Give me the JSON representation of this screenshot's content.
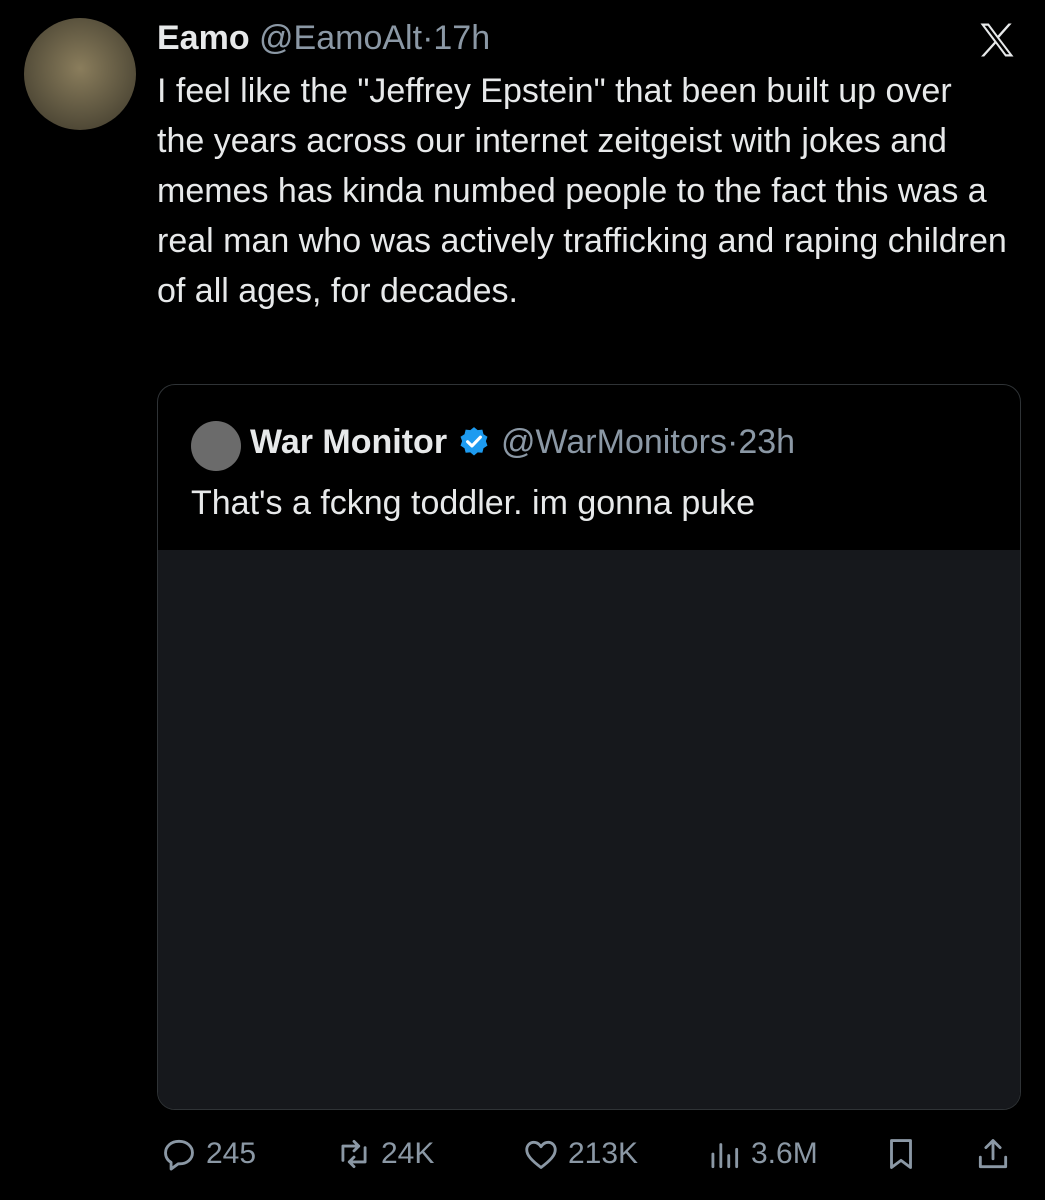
{
  "tweet": {
    "author_name": "Eamo",
    "author_handle": "@EamoAlt",
    "separator": "·",
    "time": "17h",
    "text": "I feel like the \"Jeffrey Epstein\" that been built up over the years across our internet zeitgeist with jokes and memes has kinda numbed people to the fact this was a real man who was actively trafficking and raping children of all ages, for decades."
  },
  "quoted": {
    "author_name": "War Monitor",
    "author_handle": "@WarMonitors",
    "separator": "·",
    "time": "23h",
    "text": "That's a fckng toddler. im gonna puke"
  },
  "actions": {
    "replies": "245",
    "reposts": "24K",
    "likes": "213K",
    "views": "3.6M"
  },
  "colors": {
    "background": "#000000",
    "text": "#e7e9ea",
    "muted": "#8b98a5",
    "verified": "#1d9bf0",
    "border": "#2f3336"
  },
  "icons": [
    "x-logo-icon",
    "verified-badge-icon",
    "reply-icon",
    "repost-icon",
    "like-icon",
    "views-icon",
    "bookmark-icon",
    "share-icon"
  ]
}
